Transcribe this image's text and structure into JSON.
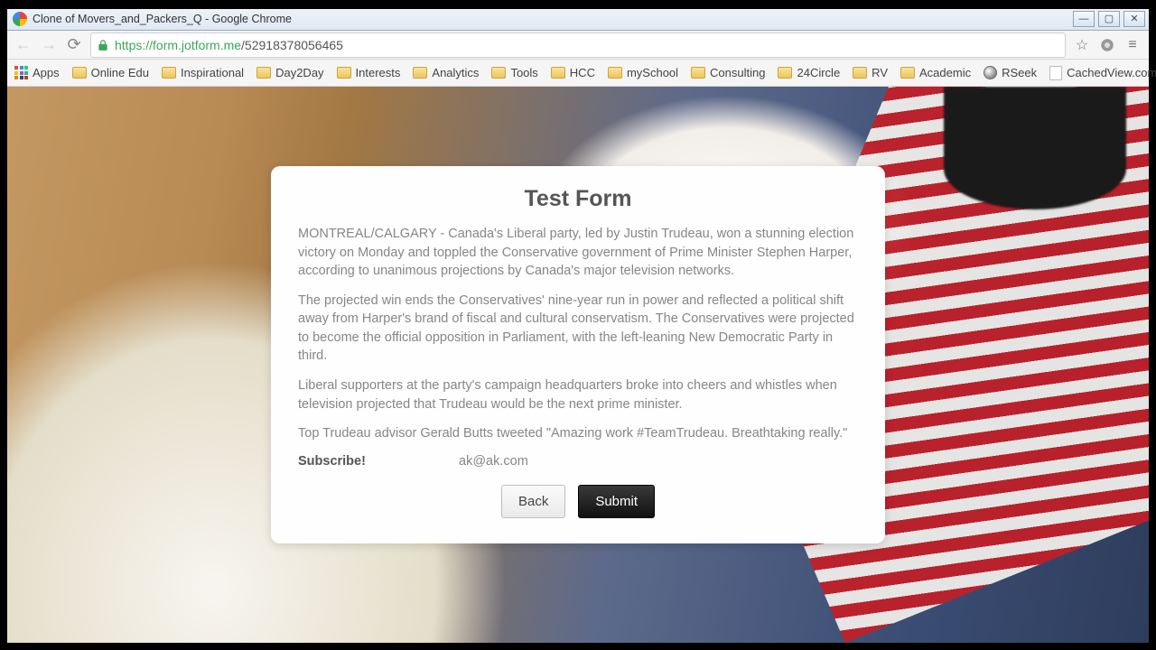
{
  "window": {
    "title": "Clone of Movers_and_Packers_Q - Google Chrome"
  },
  "url": {
    "scheme": "https://",
    "host": "form.jotform.me",
    "path": "/52918378056465"
  },
  "bookmarks": {
    "apps": "Apps",
    "items": [
      {
        "label": "Online Edu",
        "type": "folder"
      },
      {
        "label": "Inspirational",
        "type": "folder"
      },
      {
        "label": "Day2Day",
        "type": "folder"
      },
      {
        "label": "Interests",
        "type": "folder"
      },
      {
        "label": "Analytics",
        "type": "folder"
      },
      {
        "label": "Tools",
        "type": "folder"
      },
      {
        "label": "HCC",
        "type": "folder"
      },
      {
        "label": "mySchool",
        "type": "folder"
      },
      {
        "label": "Consulting",
        "type": "folder"
      },
      {
        "label": "24Circle",
        "type": "folder"
      },
      {
        "label": "RV",
        "type": "folder"
      },
      {
        "label": "Academic",
        "type": "folder"
      },
      {
        "label": "RSeek",
        "type": "rseek"
      },
      {
        "label": "CachedView.com",
        "type": "page"
      }
    ],
    "overflow": "»"
  },
  "form": {
    "title": "Test Form",
    "p1": "MONTREAL/CALGARY - Canada's Liberal party, led by Justin Trudeau, won a stunning election victory on Monday and toppled the Conservative government of Prime Minister Stephen Harper, according to unanimous projections by Canada's major television networks.",
    "p2": "The projected win ends the Conservatives' nine-year run in power and reflected a political shift away from Harper's brand of fiscal and cultural conservatism. The Conservatives were projected to become the official opposition in Parliament, with the left-leaning New Democratic Party in third.",
    "p3": "Liberal supporters at the party's campaign headquarters broke into cheers and whistles when television projected that Trudeau would be the next prime minister.",
    "p4": "Top Trudeau advisor Gerald Butts tweeted \"Amazing work #TeamTrudeau. Breathtaking really.\"",
    "subscribe_label": "Subscribe!",
    "subscribe_value": "ak@ak.com",
    "back": "Back",
    "submit": "Submit"
  }
}
